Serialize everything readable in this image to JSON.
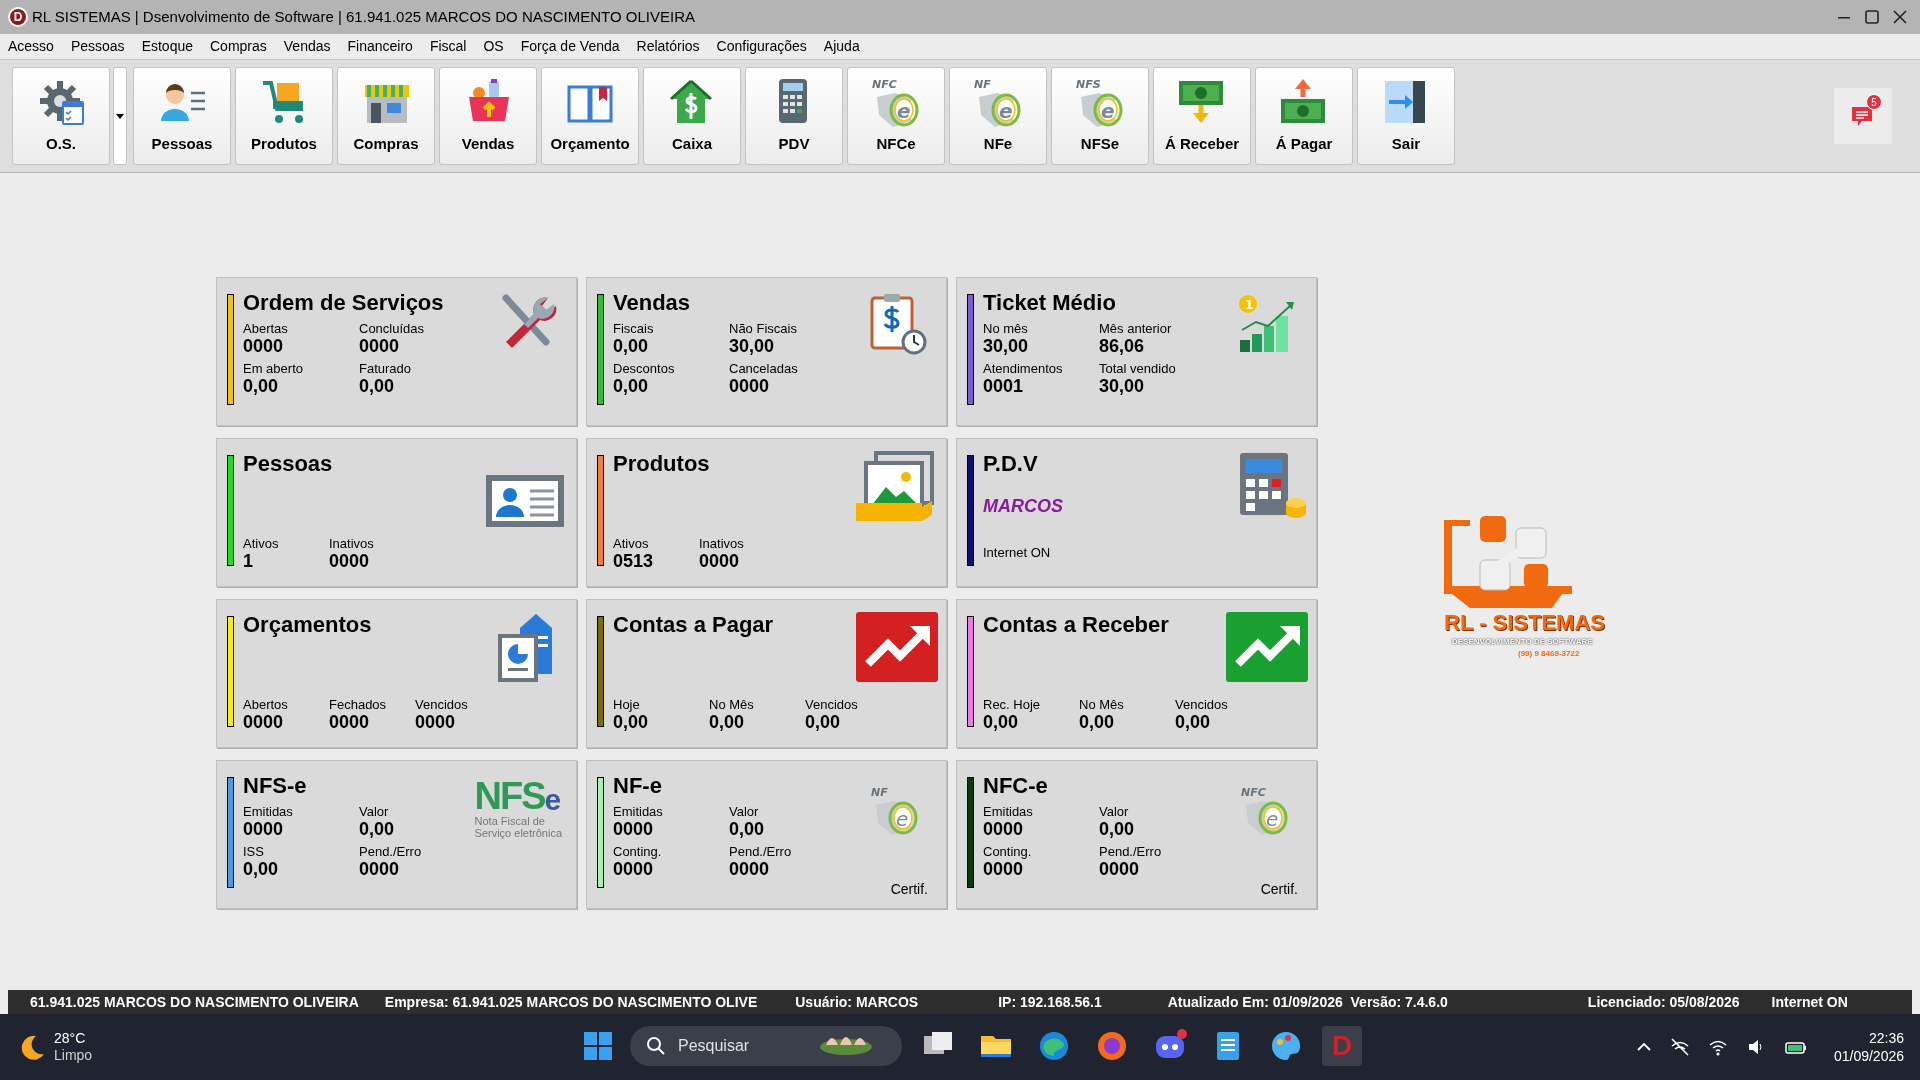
{
  "window": {
    "icon_letter": "D",
    "title": "RL SISTEMAS | Dsenvolvimento de Software | 61.941.025 MARCOS DO NASCIMENTO OLIVEIRA"
  },
  "menu": [
    "Acesso",
    "Pessoas",
    "Estoque",
    "Compras",
    "Vendas",
    "Financeiro",
    "Fiscal",
    "OS",
    "Força de Venda",
    "Relatórios",
    "Configurações",
    "Ajuda"
  ],
  "toolbar": [
    {
      "kind": "gear",
      "label": "O.S.",
      "dropdown": true
    },
    {
      "kind": "person",
      "label": "Pessoas",
      "dropdown": false
    },
    {
      "kind": "cart",
      "label": "Produtos",
      "dropdown": false
    },
    {
      "kind": "store",
      "label": "Compras",
      "dropdown": false
    },
    {
      "kind": "basket",
      "label": "Vendas",
      "dropdown": false
    },
    {
      "kind": "book",
      "label": "Orçamento",
      "dropdown": false
    },
    {
      "kind": "house",
      "label": "Caixa",
      "dropdown": false
    },
    {
      "kind": "terminal",
      "label": "PDV",
      "dropdown": false
    },
    {
      "kind": "fiscal",
      "label": "NFCe",
      "icon_text": [
        "NFC",
        "e"
      ],
      "dropdown": false
    },
    {
      "kind": "fiscal",
      "label": "NFe",
      "icon_text": [
        "NF",
        "e"
      ],
      "dropdown": false
    },
    {
      "kind": "fiscal",
      "label": "NFSe",
      "icon_text": [
        "NFS",
        "e"
      ],
      "dropdown": false
    },
    {
      "kind": "money_in",
      "label": "Á Receber",
      "dropdown": false
    },
    {
      "kind": "money_out",
      "label": "Á Pagar",
      "dropdown": false
    },
    {
      "kind": "exit",
      "label": "Sair",
      "dropdown": false
    }
  ],
  "notifications": {
    "count": "5"
  },
  "cards": [
    {
      "kind": "tools",
      "title": "Ordem de Serviços",
      "color": "#f5c400",
      "fields": [
        [
          {
            "label": "Abertas",
            "value": "0000"
          },
          {
            "label": "Concluídas",
            "value": "0000"
          }
        ],
        [
          {
            "label": "Em aberto",
            "value": "0,00"
          },
          {
            "label": "Faturado",
            "value": "0,00"
          }
        ]
      ]
    },
    {
      "kind": "clipboard",
      "title": "Vendas",
      "color": "#2ec02e",
      "fields": [
        [
          {
            "label": "Fiscais",
            "value": "0,00"
          },
          {
            "label": "Não Fiscais",
            "value": "30,00"
          }
        ],
        [
          {
            "label": "Descontos",
            "value": "0,00"
          },
          {
            "label": "Canceladas",
            "value": "0000"
          }
        ]
      ]
    },
    {
      "kind": "growth",
      "title": "Ticket Médio",
      "color": "#7b5cd6",
      "icon_text": [
        "1"
      ],
      "fields": [
        [
          {
            "label": "No mês",
            "value": "30,00"
          },
          {
            "label": "Mês anterior",
            "value": "86,06"
          }
        ],
        [
          {
            "label": "Atendimentos",
            "value": "0001"
          },
          {
            "label": "Total vendido",
            "value": "30,00"
          }
        ]
      ]
    },
    {
      "kind": "idcard",
      "title": "Pessoas",
      "color": "#22dd22",
      "fields": [
        [
          {
            "label": "Ativos",
            "value": "1"
          },
          {
            "label": "Inativos",
            "value": "0000"
          }
        ]
      ]
    },
    {
      "kind": "image",
      "title": "Produtos",
      "color": "#f47c3c",
      "fields": [
        [
          {
            "label": "Ativos",
            "value": "0513"
          },
          {
            "label": "Inativos",
            "value": "0000"
          }
        ]
      ]
    },
    {
      "kind": "calculator",
      "title": "P.D.V",
      "color": "#101070",
      "operator": "MARCOS",
      "status": "Internet ON"
    },
    {
      "kind": "report",
      "title": "Orçamentos",
      "color": "#f5f000",
      "fields": [
        [
          {
            "label": "Abertos",
            "value": "0000"
          },
          {
            "label": "Fechados",
            "value": "0000"
          },
          {
            "label": "Vencidos",
            "value": "0000"
          }
        ]
      ]
    },
    {
      "kind": "trend_red",
      "title": "Contas a Pagar",
      "color": "#7a7000",
      "fields": [
        [
          {
            "label": "Hoje",
            "value": "0,00"
          },
          {
            "label": "No Mês",
            "value": "0,00"
          },
          {
            "label": "Vencidos",
            "value": "0,00"
          }
        ]
      ]
    },
    {
      "kind": "trend_green",
      "title": "Contas a Receber",
      "color": "#f07ae8",
      "fields": [
        [
          {
            "label": "Rec. Hoje",
            "value": "0,00"
          },
          {
            "label": "No Mês",
            "value": "0,00"
          },
          {
            "label": "Vencidos",
            "value": "0,00"
          }
        ]
      ]
    },
    {
      "kind": "nfse_logo",
      "title": "NFS-e",
      "color": "#4a9ae8",
      "icon_text": [
        "NFS",
        "e",
        "Nota Fiscal de",
        "Serviço eletrônica"
      ],
      "fields": [
        [
          {
            "label": "Emitidas",
            "value": "0000"
          },
          {
            "label": "Valor",
            "value": "0,00"
          }
        ],
        [
          {
            "label": "ISS",
            "value": "0,00"
          },
          {
            "label": "Pend./Erro",
            "value": "0000"
          }
        ]
      ]
    },
    {
      "kind": "fiscal",
      "title": "NF-e",
      "color": "#a8f0b0",
      "icon_text": [
        "NF",
        "e"
      ],
      "footnote": "Certif.",
      "fields": [
        [
          {
            "label": "Emitidas",
            "value": "0000"
          },
          {
            "label": "Valor",
            "value": "0,00"
          }
        ],
        [
          {
            "label": "Conting.",
            "value": "0000"
          },
          {
            "label": "Pend./Erro",
            "value": "0000"
          }
        ]
      ]
    },
    {
      "kind": "fiscal",
      "title": "NFC-e",
      "color": "#0a3a0a",
      "icon_text": [
        "NFC",
        "e"
      ],
      "footnote": "Certif.",
      "fields": [
        [
          {
            "label": "Emitidas",
            "value": "0000"
          },
          {
            "label": "Valor",
            "value": "0,00"
          }
        ],
        [
          {
            "label": "Conting.",
            "value": "0000"
          },
          {
            "label": "Pend./Erro",
            "value": "0000"
          }
        ]
      ]
    }
  ],
  "logo": {
    "name": "RL - SISTEMAS",
    "tagline": "DESENVOLVIMENTO DE SOFTWARE",
    "phone": "(99) 9 8469-3722"
  },
  "status_bar": [
    "61.941.025 MARCOS DO NASCIMENTO OLIVEIRA",
    "Empresa: 61.941.025 MARCOS DO NASCIMENTO OLIVE",
    "Usuário: MARCOS",
    "IP: 192.168.56.1",
    "Atualizado Em: 01/09/2026  Versão: 7.4.6.0",
    "Licenciado: 05/08/2026",
    "Internet ON"
  ],
  "taskbar": {
    "temperature": "28°C",
    "weather": "Limpo",
    "search_placeholder": "Pesquisar",
    "apps": [
      {
        "kind": "taskview"
      },
      {
        "kind": "folder"
      },
      {
        "kind": "edge"
      },
      {
        "kind": "firefox"
      },
      {
        "kind": "discord"
      },
      {
        "kind": "notepad"
      },
      {
        "kind": "paint"
      },
      {
        "kind": "app",
        "letter": "D"
      }
    ],
    "time": "22:36",
    "date": "01/09/2026"
  }
}
